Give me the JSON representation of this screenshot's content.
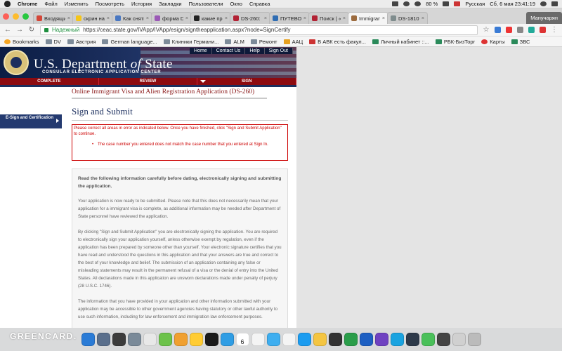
{
  "menubar": {
    "app": "Chrome",
    "items": [
      "Файл",
      "Изменить",
      "Посмотреть",
      "История",
      "Закладки",
      "Пользователи",
      "Окно",
      "Справка"
    ],
    "battery": "80 %",
    "input_lang": "Русская",
    "clock": "Сб, 6 мая  23:41:19"
  },
  "tabs": [
    {
      "label": "Входящие",
      "color": "#d44638",
      "active": false
    },
    {
      "label": "скрин на иммиг",
      "color": "#f5c518",
      "active": false
    },
    {
      "label": "Как снять в",
      "color": "#4a78c2",
      "active": false
    },
    {
      "label": "форма DS-",
      "color": "#9b59b6",
      "active": false
    },
    {
      "label": "какие проб",
      "color": "#222222",
      "active": false
    },
    {
      "label": "DS-260: зап",
      "color": "#b22234",
      "active": false
    },
    {
      "label": "ПУТЕВОДИ",
      "color": "#2f6db3",
      "active": false
    },
    {
      "label": "Поиск | «Гр",
      "color": "#b22234",
      "active": false
    },
    {
      "label": "Immigrant V",
      "color": "#9c6b3e",
      "active": true
    },
    {
      "label": "DS-1810.pd",
      "color": "#7f8c8d",
      "active": false
    }
  ],
  "profile_name": "Манучарян",
  "addressbar": {
    "secure_label": "Надежный",
    "url": "https://ceac.state.gov/IVApp/IVApp/esign/signtheapplication.aspx?node=SignCertify"
  },
  "bookmarks": [
    "Bookmarks",
    "DV",
    "Австрия",
    "German language...",
    "Клиники Германи...",
    "ALM",
    "Ремонт",
    "ААЦ",
    "В АВК есть факул...",
    "Личный кабинет ::...",
    "РБК-БизТорг",
    "Карты",
    "ЗВС"
  ],
  "site": {
    "title_main": "U.S. Department",
    "title_of": " of ",
    "title_state": "State",
    "subtitle": "CONSULAR ELECTRONIC APPLICATION CENTER",
    "toplinks": [
      "Home",
      "Contact Us",
      "Help",
      "Sign Out"
    ],
    "steps": [
      "COMPLETE",
      "REVIEW",
      "SIGN"
    ],
    "app_title": "Online Immigrant Visa and Alien Registration Application (DS-260)",
    "heading": "Sign and Submit",
    "sidenav_item": "E-Sign and Certification",
    "error_intro": "Please correct all areas in error as indicated below. Once you have finished, click \"Sign and Submit Application\" to continue.",
    "error_item": "The case number you entered does not match the case number that you entered at Sign In.",
    "read_heading": "Read the following information carefully before dating, electronically signing and submitting the application.",
    "para1": "Your application is now ready to be submitted. Please note that this does not necessarily mean that your application for a immigrant visa is complete, as additional information may be needed after Department of State personnel have reviewed the application.",
    "para2": "By clicking \"Sign and Submit Application\" you are electronically signing the application. You are required to electronically sign your application yourself, unless otherwise exempt by regulation, even if the application has been prepared by someone other than yourself. Your electronic signature certifies that you have read and understood the questions in this application and that your answers are true and correct to the best of your knowledge and belief. The submission of an application containing any false or misleading statements may result in the permanent refusal of a visa or the denial of entry into the United States. All declarations made in this application are unsworn declarations made under penalty of perjury (28 U.S.C. 1746).",
    "para3": "The information that you have provided in your application and other information submitted with your application may be accessible to other government agencies having statutory or other lawful authority to use such information, including for law enforcement and immigration law enforcement purposes."
  },
  "dock": {
    "watermark": "GREENCARD.",
    "calendar_day": "6",
    "icon_colors": [
      "#2a7bd6",
      "#5a6f8c",
      "#3c3c3c",
      "#7a8a99",
      "#e8e8e8",
      "#6cc24a",
      "#f0a030",
      "#ffcc33",
      "#1a1a1a",
      "#2f9de4",
      "#e24a3b",
      "#f4f4f4",
      "#3eaef0",
      "#f4f4f4",
      "#1b9cf0",
      "#f4c542",
      "#333333",
      "#2a9d4a",
      "#1d5fc2",
      "#6f42c1",
      "#1aa3e0",
      "#2e3a4a",
      "#4ac05a",
      "#444444",
      "#d0d0d0",
      "#bbbbbb"
    ]
  }
}
